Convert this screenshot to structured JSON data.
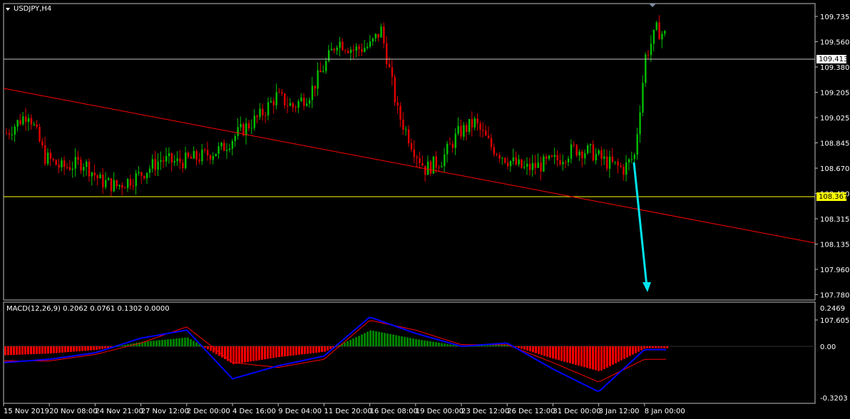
{
  "header": {
    "symbol_title": "USDJPY,H4",
    "dropdown_icon": "triangle-down-icon"
  },
  "macd": {
    "label": "MACD(12,26,9) 0.2062 0.0761 0.1302 0.0000"
  },
  "price_axis": {
    "ticks": [
      "109.735",
      "109.560",
      "109.380",
      "109.205",
      "109.025",
      "108.845",
      "108.670",
      "108.490",
      "108.315",
      "108.135",
      "107.960",
      "107.780",
      "107.605"
    ],
    "current_price_label": "109.413",
    "level_label": "108.367"
  },
  "macd_axis": {
    "ticks": [
      "0.2469",
      "0.00",
      "-0.3203"
    ]
  },
  "time_axis": {
    "ticks": [
      "15 Nov 2019",
      "20 Nov 08:00",
      "24 Nov 21:00",
      "27 Nov 12:00",
      "2 Dec 00:00",
      "4 Dec 16:00",
      "9 Dec 04:00",
      "11 Dec 20:00",
      "16 Dec 08:00",
      "19 Dec 00:00",
      "23 Dec 12:00",
      "26 Dec 12:00",
      "31 Dec 00:00",
      "3 Jan 12:00",
      "8 Jan 00:00"
    ]
  },
  "colors": {
    "background": "#000000",
    "bull": "#00c000",
    "bear": "#e00000",
    "macd_line": "#0000ff",
    "signal_line": "#ff0000",
    "hist_pos": "#008000",
    "hist_neg": "#ff0000",
    "trendline": "#ff0000",
    "horizontal_level": "#ffff00",
    "current_price_line": "#c0c0c0",
    "arrow": "#00e5ee"
  },
  "chart_data": {
    "type": "candlestick",
    "title": "USDJPY,H4",
    "y_range": [
      107.56,
      109.8
    ],
    "x_range_bars": [
      0,
      240
    ],
    "close_path": [
      [
        0,
        108.82
      ],
      [
        8,
        108.98
      ],
      [
        14,
        108.64
      ],
      [
        20,
        108.56
      ],
      [
        28,
        108.6
      ],
      [
        34,
        108.46
      ],
      [
        40,
        108.42
      ],
      [
        48,
        108.5
      ],
      [
        56,
        108.62
      ],
      [
        62,
        108.6
      ],
      [
        70,
        108.64
      ],
      [
        78,
        108.7
      ],
      [
        84,
        108.82
      ],
      [
        92,
        108.95
      ],
      [
        98,
        109.1
      ],
      [
        104,
        109.02
      ],
      [
        110,
        109.12
      ],
      [
        116,
        109.35
      ],
      [
        120,
        109.52
      ],
      [
        126,
        109.45
      ],
      [
        132,
        109.48
      ],
      [
        136,
        109.6
      ],
      [
        138,
        109.4
      ],
      [
        142,
        108.98
      ],
      [
        148,
        108.7
      ],
      [
        152,
        108.55
      ],
      [
        158,
        108.62
      ],
      [
        164,
        108.82
      ],
      [
        170,
        108.9
      ],
      [
        176,
        108.72
      ],
      [
        182,
        108.62
      ],
      [
        188,
        108.55
      ],
      [
        194,
        108.58
      ],
      [
        200,
        108.62
      ],
      [
        206,
        108.7
      ],
      [
        212,
        108.68
      ],
      [
        218,
        108.6
      ],
      [
        224,
        108.55
      ],
      [
        228,
        108.65
      ],
      [
        232,
        109.4
      ],
      [
        236,
        109.6
      ],
      [
        240,
        109.55
      ]
    ],
    "candle_count": 240,
    "horizontal_levels": [
      108.367
    ],
    "current_price": 109.413,
    "trendline": {
      "from": [
        "15 Nov 2019",
        109.2
      ],
      "to": [
        "8 Jan 00:00",
        108.0
      ]
    },
    "arrow": {
      "from": [
        "3 Jan 12:00",
        108.66
      ],
      "to": [
        "8 Jan 00:00",
        107.66
      ]
    },
    "macd": {
      "label": "MACD(12,26,9) 0.2062 0.0761 0.1302 0.0000",
      "y_range": [
        -0.3203,
        0.2469
      ],
      "values_at_ticks": {
        "x": [
          "15 Nov 2019",
          "20 Nov 08:00",
          "24 Nov 21:00",
          "27 Nov 12:00",
          "2 Dec 00:00",
          "4 Dec 16:00",
          "9 Dec 04:00",
          "11 Dec 20:00",
          "16 Dec 08:00",
          "19 Dec 00:00",
          "23 Dec 12:00",
          "26 Dec 12:00",
          "31 Dec 00:00",
          "3 Jan 12:00",
          "8 Jan 00:00"
        ],
        "macd": [
          -0.1,
          -0.08,
          -0.04,
          0.05,
          0.1,
          -0.2,
          -0.12,
          -0.06,
          0.18,
          0.08,
          0.0,
          0.02,
          -0.14,
          -0.28,
          -0.02
        ],
        "signal": [
          -0.09,
          -0.09,
          -0.05,
          0.02,
          0.12,
          -0.1,
          -0.13,
          -0.08,
          0.16,
          0.1,
          0.01,
          0.01,
          -0.1,
          -0.22,
          -0.08
        ]
      }
    }
  }
}
